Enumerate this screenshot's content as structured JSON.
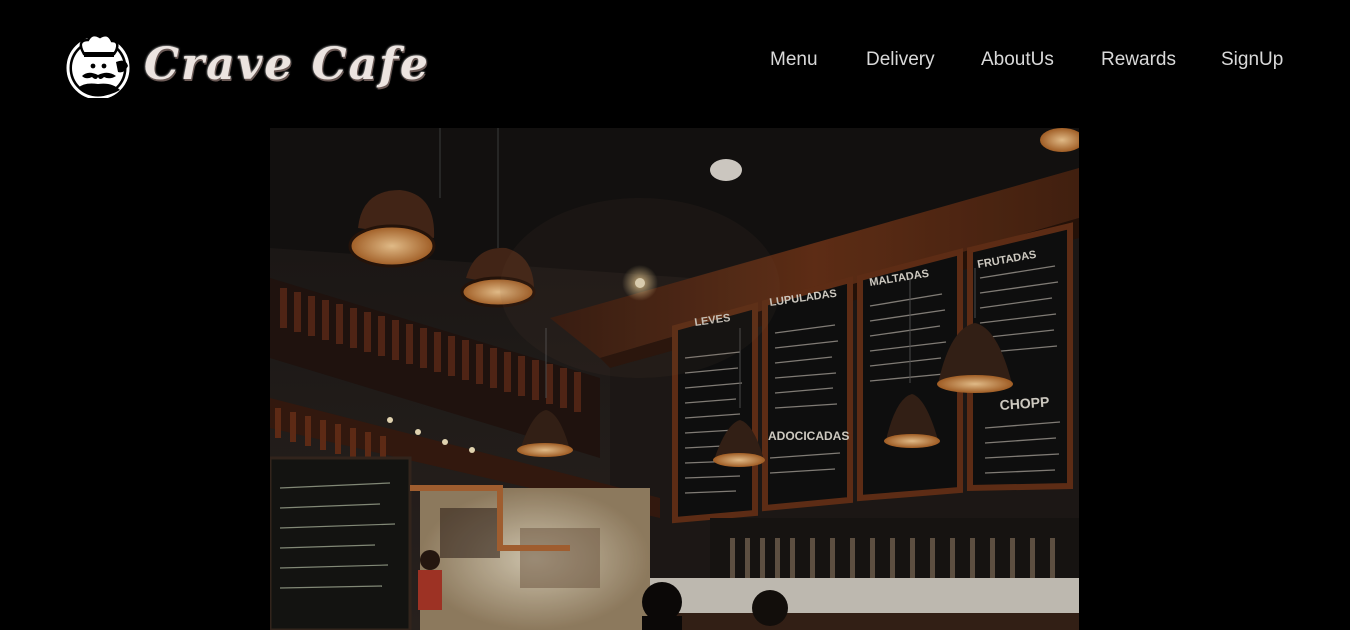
{
  "brand": {
    "name": "Crave Cafe",
    "logo_icon": "chef-mustache-icon"
  },
  "nav": {
    "items": [
      {
        "label": "Menu"
      },
      {
        "label": "Delivery"
      },
      {
        "label": "AboutUs"
      },
      {
        "label": "Rewards"
      },
      {
        "label": "SignUp"
      }
    ]
  },
  "hero": {
    "image_icon": "cafe-interior-photo",
    "boards": [
      "LEVES",
      "LUPULADAS",
      "MALTADAS",
      "FRUTADAS",
      "ADOCICADAS",
      "CHOPP"
    ]
  },
  "colors": {
    "background": "#000000",
    "nav_text": "#d9d9d9",
    "logo_text": "#ece4e0"
  }
}
